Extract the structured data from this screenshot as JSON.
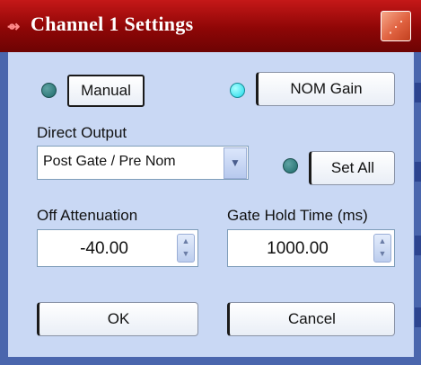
{
  "window": {
    "title": "Channel 1 Settings",
    "app_icon": "channel-settings-icon",
    "close_icon": "close-icon"
  },
  "colors": {
    "titlebar": "#a90d0d",
    "panel": "#c9d8f4",
    "frame": "#4a66ad",
    "led_lit": "#1ed8e8",
    "led_dim": "#2a7f7f"
  },
  "controls": {
    "manual_label": "Manual",
    "nom_gain_label": "NOM Gain",
    "direct_output_label": "Direct Output",
    "direct_output_value": "Post Gate / Pre Nom",
    "set_all_label": "Set All",
    "off_attenuation_label": "Off Attenuation",
    "off_attenuation_value": "-40.00",
    "gate_hold_time_label": "Gate Hold Time (ms)",
    "gate_hold_time_value": "1000.00",
    "ok_label": "OK",
    "cancel_label": "Cancel"
  },
  "indicators": {
    "manual_led": "dim",
    "nom_gain_led": "lit",
    "set_all_led": "dim"
  }
}
